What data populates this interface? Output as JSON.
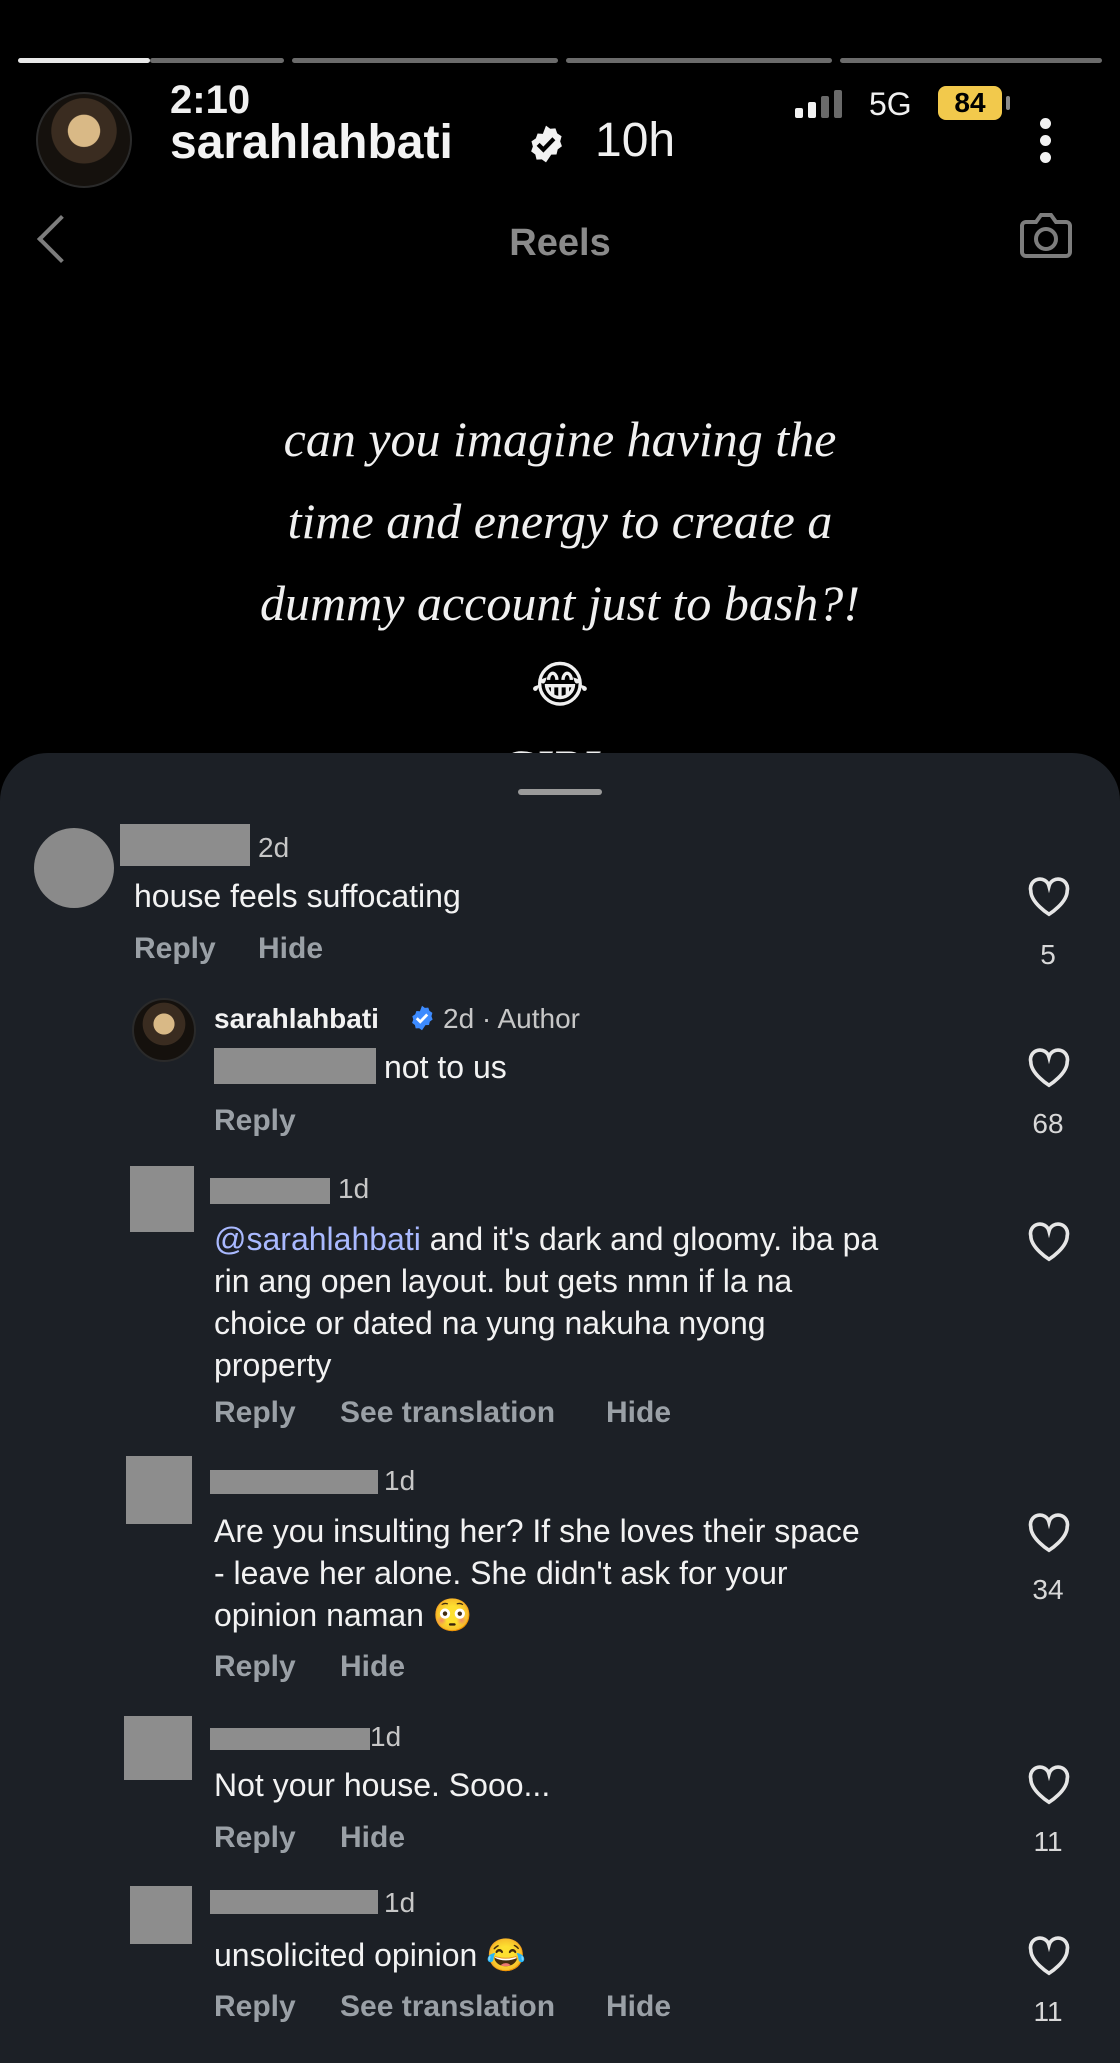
{
  "story": {
    "clock": "2:10",
    "username": "sarahlahbati",
    "time_ago": "10h",
    "signal": "5G",
    "battery": "84",
    "progress_segments": 4,
    "active_segment": 1
  },
  "header": {
    "title": "Reels"
  },
  "story_text": {
    "line1": "can you imagine having the",
    "line2": "time and energy to create a",
    "line3": "dummy account just to bash?!",
    "emoji": "😂",
    "line4": "GIRL."
  },
  "comments": [
    {
      "time": "2d",
      "text": "house feels suffocating",
      "reply": "Reply",
      "hide": "Hide",
      "likes": "5"
    },
    {
      "author": "sarahlahbati",
      "time": "2d · Author",
      "text": "not to us",
      "reply": "Reply",
      "likes": "68"
    },
    {
      "time": "1d",
      "mention": "@sarahlahbati",
      "text": " and it's dark and gloomy. iba pa rin ang open layout. but gets nmn if la na choice or dated na yung nakuha nyong property",
      "line1": " and it's dark and gloomy. iba pa",
      "line2": "rin ang open layout. but gets nmn if la na",
      "line3": "choice or dated na yung nakuha nyong",
      "line4": "property",
      "reply": "Reply",
      "translate": "See translation",
      "hide": "Hide"
    },
    {
      "time": "1d",
      "line1": "Are you insulting her? If she loves their space",
      "line2": "- leave her alone. She didn't ask for your",
      "line3": "opinion naman 😳",
      "reply": "Reply",
      "hide": "Hide",
      "likes": "34"
    },
    {
      "time": "1d",
      "text": "Not your house. Sooo...",
      "reply": "Reply",
      "hide": "Hide",
      "likes": "11"
    },
    {
      "time": "1d",
      "text": "unsolicited opinion 😂",
      "reply": "Reply",
      "translate": "See translation",
      "hide": "Hide",
      "likes": "11"
    }
  ]
}
